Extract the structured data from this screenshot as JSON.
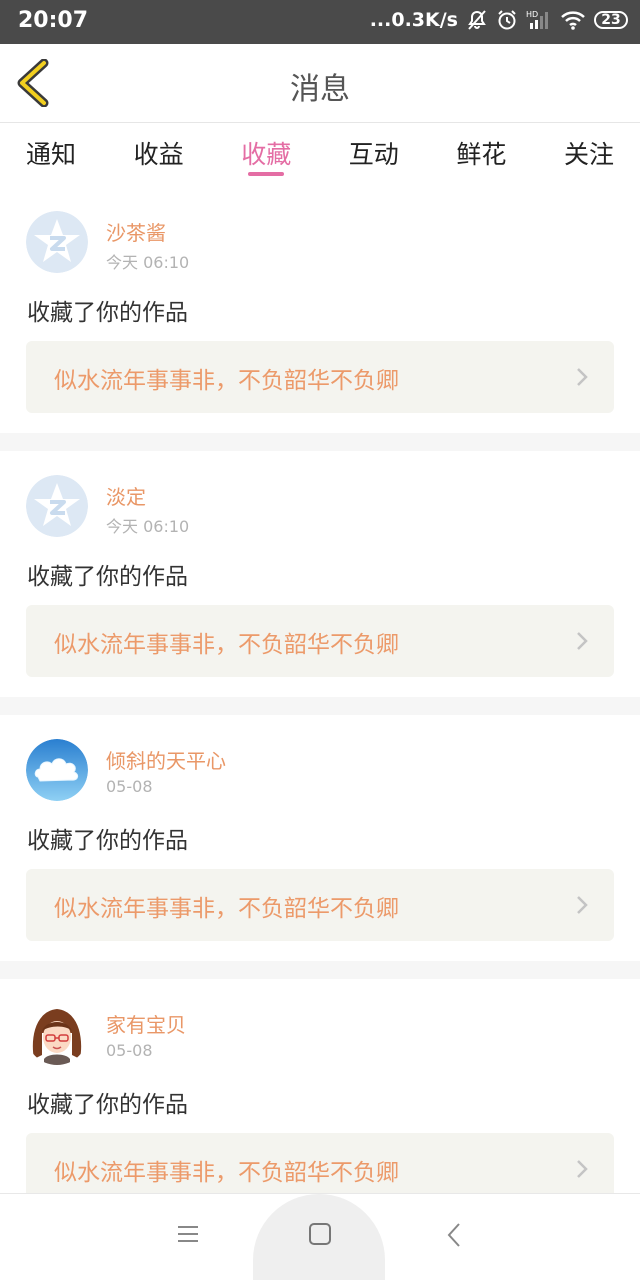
{
  "status": {
    "time": "20:07",
    "net_speed": "...0.3K/s",
    "battery": "23",
    "icons": [
      "mute-bell-icon",
      "alarm-icon",
      "hd-signal-icon",
      "wifi-icon",
      "battery-icon"
    ]
  },
  "header": {
    "title": "消息",
    "back_icon": "chevron-left-icon"
  },
  "tabs": [
    {
      "label": "通知"
    },
    {
      "label": "收益"
    },
    {
      "label": "收藏",
      "active": true
    },
    {
      "label": "互动"
    },
    {
      "label": "鲜花"
    },
    {
      "label": "关注"
    }
  ],
  "messages": [
    {
      "user": "沙茶酱",
      "time": "今天 06:10",
      "action": "收藏了你的作品",
      "work": "似水流年事事非，不负韶华不负卿",
      "avatar": "qzone-default-avatar"
    },
    {
      "user": "淡定",
      "time": "今天 06:10",
      "action": "收藏了你的作品",
      "work": "似水流年事事非，不负韶华不负卿",
      "avatar": "qzone-default-avatar"
    },
    {
      "user": "倾斜的天平心",
      "time": "05-08",
      "action": "收藏了你的作品",
      "work": "似水流年事事非，不负韶华不负卿",
      "avatar": "cloud-avatar"
    },
    {
      "user": "家有宝贝",
      "time": "05-08",
      "action": "收藏了你的作品",
      "work": "似水流年事事非，不负韶华不负卿",
      "avatar": "girl-avatar"
    }
  ],
  "colors": {
    "accent": "#e46da4",
    "username": "#e99767",
    "work_title": "#ec9a6a",
    "work_box_bg": "#f4f4ef",
    "statusbar_bg": "#4a4a4a"
  },
  "navbar": {
    "icons": [
      "menu-icon",
      "home-square-icon",
      "back-triangle-icon"
    ]
  }
}
